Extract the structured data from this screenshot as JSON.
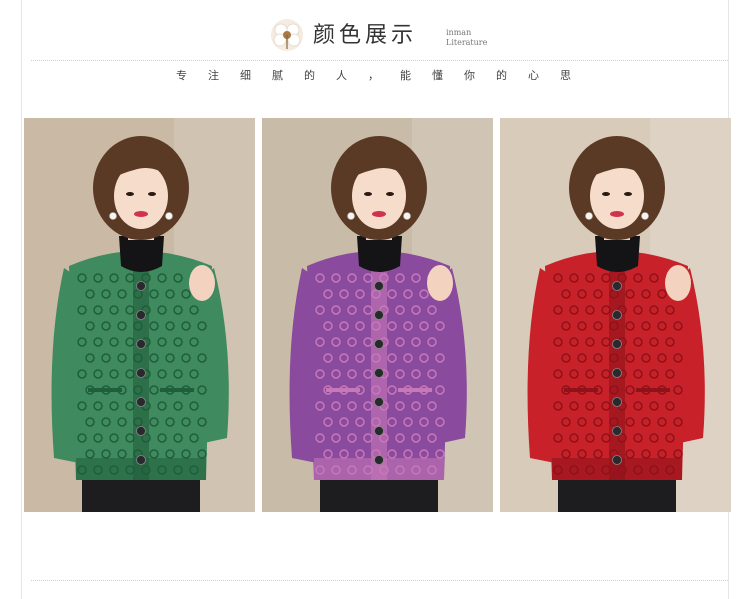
{
  "header": {
    "title": "颜色展示",
    "subtitle_line1": "inman",
    "subtitle_line2": "Literature",
    "tagline": "专注细腻的人，能懂你的心思"
  },
  "photos": [
    {
      "color_name": "green",
      "sweater_color": "#3f8a5e",
      "pattern_color": "#1f5e3a",
      "bg_color": "#c9b9a5"
    },
    {
      "color_name": "purple",
      "sweater_color": "#8a4a9e",
      "pattern_color": "#c778b8",
      "bg_color": "#c8bba8"
    },
    {
      "color_name": "red",
      "sweater_color": "#c8212a",
      "pattern_color": "#8e121a",
      "bg_color": "#d8cbba"
    }
  ],
  "colors": {
    "title_text": "#333333",
    "tagline_text": "#444444",
    "divider": "#cfcfcf"
  }
}
